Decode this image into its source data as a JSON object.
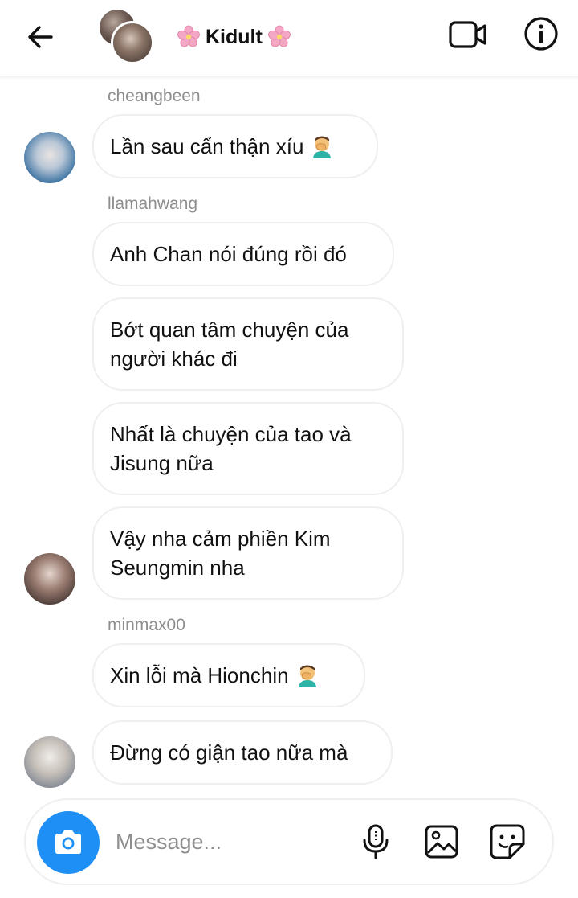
{
  "header": {
    "title": "Kidult",
    "title_decoration_icon": "cherry-blossom-icon",
    "back_icon": "arrow-left-icon",
    "video_icon": "video-camera-icon",
    "info_icon": "info-icon"
  },
  "messages": [
    {
      "sender": "cheangbeen",
      "text": "Lần sau cẩn thận xíu",
      "emoji": "facepalm-icon",
      "avatar": true
    },
    {
      "sender": "llamahwang",
      "text": "Anh Chan nói đúng rồi đó",
      "avatar": false
    },
    {
      "text": "Bớt quan tâm chuyện của\nngười khác đi",
      "avatar": false
    },
    {
      "text": "Nhất là chuyện của tao và\nJisung nữa",
      "avatar": false
    },
    {
      "text": "Vậy nha cảm phiền Kim\nSeungmin nha",
      "avatar": true
    },
    {
      "sender": "minmax00",
      "text": "Xin lỗi mà Hionchin",
      "emoji": "facepalm-icon",
      "avatar": false
    },
    {
      "text": "Đừng có giận tao nữa mà",
      "avatar": true
    }
  ],
  "composer": {
    "placeholder": "Message...",
    "camera_icon": "camera-icon",
    "mic_icon": "microphone-icon",
    "gallery_icon": "image-icon",
    "sticker_icon": "sticker-icon"
  },
  "colors": {
    "accent": "#1e90f5",
    "sender_text": "#8e8e8e",
    "bubble_border": "#efefef",
    "blossom": "#f4a7c4"
  }
}
